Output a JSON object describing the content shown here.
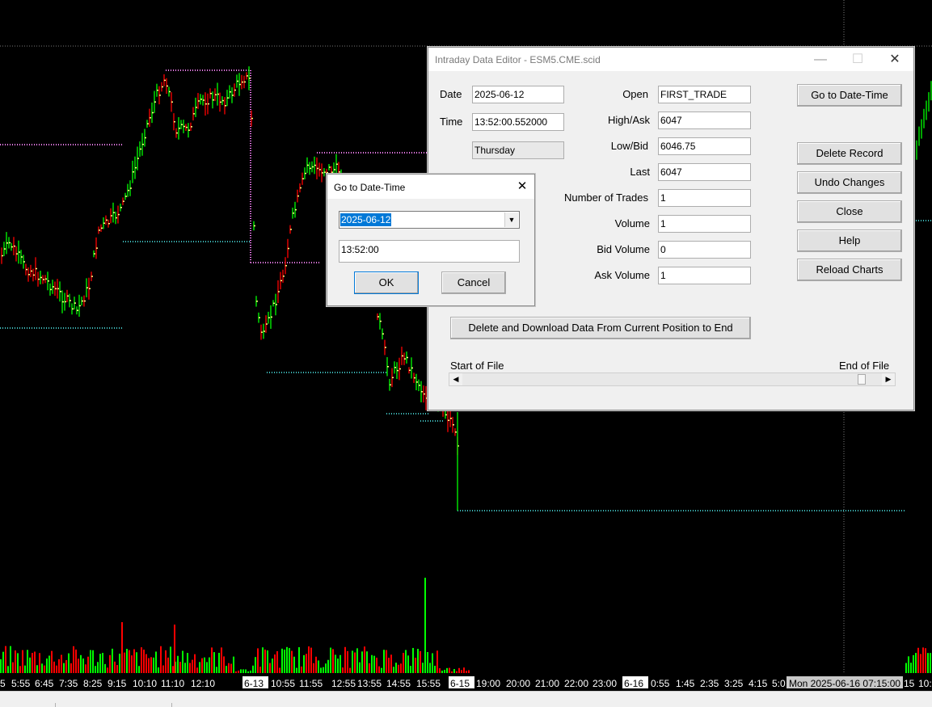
{
  "chart": {
    "background": "#000000",
    "up_color": "#00ff00",
    "down_color": "#ff0000",
    "close_color": "#ffff80",
    "high_line_color": "#ff80ff",
    "low_line_color": "#40c0c0",
    "time_axis": {
      "labels": [
        "5",
        "5:55",
        "6:45",
        "7:35",
        "8:25",
        "9:15",
        "10:10",
        "11:10",
        "12:10",
        "6-13",
        "10:55",
        "11:55",
        "12:55",
        "13:55",
        "14:55",
        "15:55",
        "6-15",
        "19:00",
        "20:00",
        "21:00",
        "22:00",
        "23:00",
        "6-16",
        "0:55",
        "1:45",
        "2:35",
        "3:25",
        "4:15",
        "5:0",
        "Mon 2025-06-16  07:15:00",
        "15",
        "10:1"
      ],
      "highlighted": [
        "6-13",
        "6-15",
        "6-16"
      ],
      "cursor_label": "Mon 2025-06-16  07:15:00"
    }
  },
  "editor": {
    "title": "Intraday Data Editor - ESM5.CME.scid",
    "controls": [
      "—",
      "☐",
      "✕"
    ],
    "date_label": "Date",
    "date_value": "2025-06-12",
    "time_label": "Time",
    "time_value": "13:52:00.552000",
    "day_value": "Thursday",
    "fields": [
      {
        "label": "Open",
        "value": "FIRST_TRADE"
      },
      {
        "label": "High/Ask",
        "value": "6047"
      },
      {
        "label": "Low/Bid",
        "value": "6046.75"
      },
      {
        "label": "Last",
        "value": "6047"
      },
      {
        "label": "Number of Trades",
        "value": "1"
      },
      {
        "label": "Volume",
        "value": "1"
      },
      {
        "label": "Bid Volume",
        "value": "0"
      },
      {
        "label": "Ask Volume",
        "value": "1"
      }
    ],
    "buttons": {
      "goto": "Go to Date-Time",
      "delete": "Delete  Record",
      "undo": "Undo Changes",
      "close": "Close",
      "help": "Help",
      "reload": "Reload Charts",
      "download": "Delete and Download Data From Current Position to End"
    },
    "start_of_file": "Start of File",
    "end_of_file": "End of File",
    "scroll_left": "◀",
    "scroll_right": "▶",
    "file_position": 0.98
  },
  "goto_dialog": {
    "title": "Go to Date-Time",
    "close": "✕",
    "date_value": "2025-06-12",
    "dropdown_arrow": "▼",
    "time_value": "13:52:00",
    "ok": "OK",
    "cancel": "Cancel"
  }
}
